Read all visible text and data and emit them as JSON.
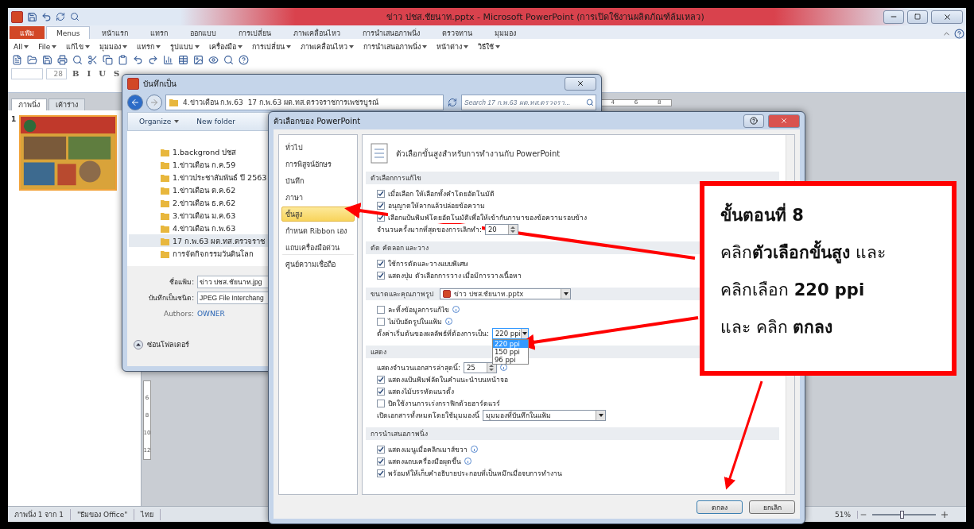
{
  "window": {
    "title": "ข่าว ปชส.ชัยนาท.pptx - Microsoft PowerPoint (การเปิดใช้งานผลิตภัณฑ์ล้มเหลว)"
  },
  "ribbon_tabs": [
    {
      "label": "แฟ้ม",
      "kind": "file",
      "selected": false
    },
    {
      "label": "Menus",
      "kind": "tab",
      "selected": true
    },
    {
      "label": "หน้าแรก",
      "kind": "tab",
      "selected": false
    },
    {
      "label": "แทรก",
      "kind": "tab",
      "selected": false
    },
    {
      "label": "ออกแบบ",
      "kind": "tab",
      "selected": false
    },
    {
      "label": "การเปลี่ยน",
      "kind": "tab",
      "selected": false
    },
    {
      "label": "ภาพเคลื่อนไหว",
      "kind": "tab",
      "selected": false
    },
    {
      "label": "การนำเสนอภาพนิ่ง",
      "kind": "tab",
      "selected": false
    },
    {
      "label": "ตรวจทาน",
      "kind": "tab",
      "selected": false
    },
    {
      "label": "มุมมอง",
      "kind": "tab",
      "selected": false
    }
  ],
  "menus": [
    "All",
    "File",
    "แก้ไข",
    "มุมมอง",
    "แทรก",
    "รูปแบบ",
    "เครื่องมือ",
    "การเปลี่ยน",
    "ภาพเคลื่อนไหว",
    "การนำเสนอภาพนิ่ง",
    "หน้าต่าง",
    "วิธีใช้"
  ],
  "font_size": "28",
  "format_buttons": [
    "B",
    "I",
    "U",
    "S"
  ],
  "slide_panel": {
    "tabs": [
      {
        "label": "ภาพนิ่ง",
        "selected": true
      },
      {
        "label": "เค้าร่าง",
        "selected": false
      }
    ],
    "slide_number": "1"
  },
  "horizontal_ruler": [
    "4",
    "6",
    "8"
  ],
  "vertical_ruler": [
    "6",
    "8",
    "10",
    "12"
  ],
  "status_bar": {
    "items": [
      "ภาพนิ่ง 1 จาก 1",
      "\"ธีมของ Office\"",
      "ไทย"
    ],
    "zoom": "51%",
    "zoom_slider": {
      "level": 0.48
    }
  },
  "save_dialog": {
    "title": "บันทึกเป็น",
    "breadcrumb": [
      "4.ข่าวเดือน ก.พ.63",
      "17 ก.พ.63 ผต.ทส.ตรวจราชการเพชรบูรณ์"
    ],
    "search": {
      "placeholder": "Search 17 ก.พ.63 ผต.ทส.ตรวจรา..."
    },
    "toolbar": [
      "Organize",
      "New folder"
    ],
    "tree": [
      {
        "label": "1.backgrond ปชส",
        "selected": false
      },
      {
        "label": "1.ข่าวเดือน ก.ค.59",
        "selected": false
      },
      {
        "label": "1.ข่าวประชาสัมพันธ์ ปี 2563",
        "selected": false,
        "children": [
          {
            "label": "1.ข่าวเดือน ต.ค.62",
            "selected": false
          },
          {
            "label": "2.ข่าวเดือน ธ.ค.62",
            "selected": false
          },
          {
            "label": "3.ข่าวเดือน ม.ค.63",
            "selected": false
          },
          {
            "label": "4.ข่าวเดือน ก.พ.63",
            "selected": false,
            "children": [
              {
                "label": "17 ก.พ.63 ผต.ทส.ตรวจราช",
                "selected": true
              }
            ]
          },
          {
            "label": "การจัดกิจกรรมวันดินโลก",
            "selected": false
          }
        ]
      }
    ],
    "fields": [
      {
        "label": "ชื่อแฟ้ม:",
        "value": "ข่าว ปชส.ชัยนาท.jpg"
      },
      {
        "label": "บันทึกเป็นชนิด:",
        "value": "JPEG File Interchang"
      }
    ],
    "authors": {
      "label": "Authors:",
      "value": "OWNER"
    },
    "hide_folders": "ซ่อนโฟลเดอร์"
  },
  "options_dialog": {
    "title": "ตัวเลือกของ PowerPoint",
    "nav": [
      {
        "label": "ทั่วไป",
        "selected": false
      },
      {
        "label": "การพิสูจน์อักษร",
        "selected": false
      },
      {
        "label": "บันทึก",
        "selected": false
      },
      {
        "label": "ภาษา",
        "selected": false
      },
      {
        "label": "ขั้นสูง",
        "selected": true
      },
      {
        "label": "กำหนด Ribbon เอง",
        "selected": false
      },
      {
        "label": "แถบเครื่องมือด่วน",
        "selected": false
      },
      {
        "label": "ศูนย์ความเชื่อถือ",
        "selected": false
      }
    ],
    "heading": "ตัวเลือกขั้นสูงสำหรับการทำงานกับ PowerPoint",
    "sections": [
      {
        "title": "ตัวเลือกการแก้ไข",
        "rows": [
          {
            "kind": "checkbox",
            "label": "เมื่อเลือก ให้เลือกทั้งคำโดยอัตโนมัติ",
            "checked": true
          },
          {
            "kind": "checkbox",
            "label": "อนุญาตให้ลากแล้วปล่อยข้อความ",
            "checked": true
          },
          {
            "kind": "checkbox",
            "label": "เลือกแป้นพิมพ์โดยอัตโนมัติเพื่อให้เข้ากับภาษาของข้อความรอบข้าง",
            "checked": true
          },
          {
            "kind": "spin",
            "label": "จำนวนครั้งมากที่สุดของการเลิกทำ:",
            "value": "20"
          }
        ]
      },
      {
        "title": "ตัด คัดลอก และวาง",
        "rows": [
          {
            "kind": "checkbox",
            "label": "ใช้การตัดและวางแบบพิเศษ",
            "checked": true
          },
          {
            "kind": "checkbox",
            "label": "แสดงปุ่ม ตัวเลือกการวาง เมื่อมีการวางเนื้อหา",
            "checked": true
          }
        ]
      },
      {
        "title": "ขนาดและคุณภาพรูป",
        "file": "ข่าว ปชส.ชัยนาท.pptx",
        "rows": [
          {
            "kind": "checkbox",
            "label": "ละทิ้งข้อมูลการแก้ไข",
            "checked": false,
            "info": true
          },
          {
            "kind": "checkbox",
            "label": "ไม่บีบอัดรูปในแฟ้ม",
            "checked": false,
            "info": true
          },
          {
            "kind": "select",
            "label": "ตั้งค่าเริ่มต้นของผลลัพธ์ที่ต้องการเป็น:",
            "value": "220 ppi",
            "expanded": true,
            "options": [
              {
                "label": "220 ppi",
                "selected": true
              },
              {
                "label": "150 ppi",
                "selected": false
              },
              {
                "label": "96 ppi",
                "selected": false
              }
            ]
          }
        ]
      },
      {
        "title": "แสดง",
        "rows": [
          {
            "kind": "spin",
            "label": "แสดงจำนวนเอกสารล่าสุดนี้:",
            "value": "25",
            "info": true
          },
          {
            "kind": "checkbox",
            "label": "แสดงแป้นพิมพ์ลัดในคำแนะนำบนหน้าจอ",
            "checked": true
          },
          {
            "kind": "checkbox",
            "label": "แสดงไม้บรรทัดแนวตั้ง",
            "checked": true
          },
          {
            "kind": "checkbox",
            "label": "ปิดใช้งานการเร่งกราฟิกด้วยฮาร์ดแวร์",
            "checked": false
          },
          {
            "kind": "select",
            "label": "เปิดเอกสารทั้งหมดโดยใช้มุมมองนี้",
            "value": "มุมมองที่บันทึกในแฟ้ม",
            "expanded": false
          }
        ]
      },
      {
        "title": "การนำเสนอภาพนิ่ง",
        "rows": [
          {
            "kind": "checkbox",
            "label": "แสดงเมนูเมื่อคลิกเมาส์ขวา",
            "checked": true,
            "info": true
          },
          {
            "kind": "checkbox",
            "label": "แสดงแถบเครื่องมือผุดขึ้น",
            "checked": true,
            "info": true
          },
          {
            "kind": "checkbox",
            "label": "พร้อมท์ให้เก็บคำอธิบายประกอบที่เป็นหมึกเมื่อจบการทำงาน",
            "checked": true
          }
        ]
      }
    ],
    "buttons": [
      "ตกลง",
      "ยกเลิก"
    ]
  },
  "callout": {
    "title": "ขั้นตอนที่ 8",
    "lines": [
      "คลิก**ตัวเลือกขั้นสูง** และ",
      "คลิกเลือก **220 ppi**",
      "และ คลิก **ตกลง**"
    ]
  }
}
